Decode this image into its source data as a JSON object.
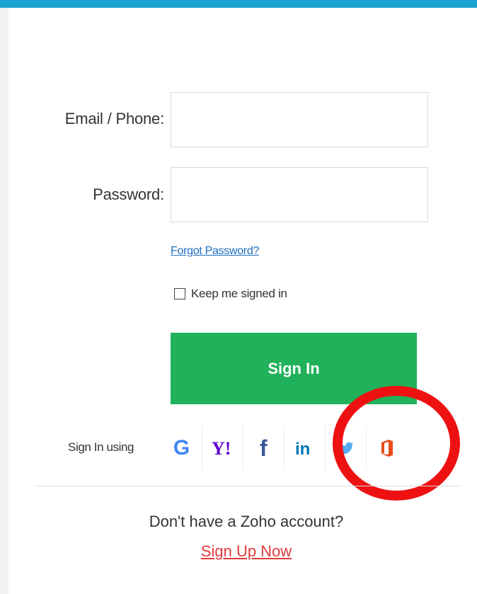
{
  "form": {
    "email_label": "Email / Phone:",
    "email_value": "",
    "password_label": "Password:",
    "password_value": "",
    "forgot_label": "Forgot Password?",
    "keep_signed_in_label": "Keep me signed in",
    "keep_signed_in_checked": false,
    "signin_label": "Sign In"
  },
  "social": {
    "label": "Sign In using",
    "providers": [
      "google-icon",
      "yahoo-icon",
      "facebook-icon",
      "linkedin-icon",
      "twitter-icon",
      "office-icon"
    ]
  },
  "footer": {
    "no_account_text": "Don't have a Zoho account?",
    "signup_label": "Sign Up Now"
  },
  "colors": {
    "topbar": "#1aa3d0",
    "signin_button": "#20b25a",
    "link": "#1f6fbf",
    "signup_link": "#e33b3b",
    "highlight_circle": "#ee1111"
  }
}
